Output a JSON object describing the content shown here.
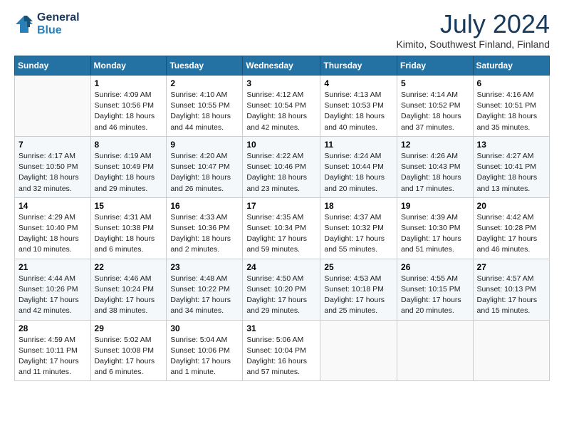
{
  "header": {
    "logo_line1": "General",
    "logo_line2": "Blue",
    "month_title": "July 2024",
    "location": "Kimito, Southwest Finland, Finland"
  },
  "weekdays": [
    "Sunday",
    "Monday",
    "Tuesday",
    "Wednesday",
    "Thursday",
    "Friday",
    "Saturday"
  ],
  "weeks": [
    [
      {
        "day": "",
        "info": ""
      },
      {
        "day": "1",
        "info": "Sunrise: 4:09 AM\nSunset: 10:56 PM\nDaylight: 18 hours\nand 46 minutes."
      },
      {
        "day": "2",
        "info": "Sunrise: 4:10 AM\nSunset: 10:55 PM\nDaylight: 18 hours\nand 44 minutes."
      },
      {
        "day": "3",
        "info": "Sunrise: 4:12 AM\nSunset: 10:54 PM\nDaylight: 18 hours\nand 42 minutes."
      },
      {
        "day": "4",
        "info": "Sunrise: 4:13 AM\nSunset: 10:53 PM\nDaylight: 18 hours\nand 40 minutes."
      },
      {
        "day": "5",
        "info": "Sunrise: 4:14 AM\nSunset: 10:52 PM\nDaylight: 18 hours\nand 37 minutes."
      },
      {
        "day": "6",
        "info": "Sunrise: 4:16 AM\nSunset: 10:51 PM\nDaylight: 18 hours\nand 35 minutes."
      }
    ],
    [
      {
        "day": "7",
        "info": "Sunrise: 4:17 AM\nSunset: 10:50 PM\nDaylight: 18 hours\nand 32 minutes."
      },
      {
        "day": "8",
        "info": "Sunrise: 4:19 AM\nSunset: 10:49 PM\nDaylight: 18 hours\nand 29 minutes."
      },
      {
        "day": "9",
        "info": "Sunrise: 4:20 AM\nSunset: 10:47 PM\nDaylight: 18 hours\nand 26 minutes."
      },
      {
        "day": "10",
        "info": "Sunrise: 4:22 AM\nSunset: 10:46 PM\nDaylight: 18 hours\nand 23 minutes."
      },
      {
        "day": "11",
        "info": "Sunrise: 4:24 AM\nSunset: 10:44 PM\nDaylight: 18 hours\nand 20 minutes."
      },
      {
        "day": "12",
        "info": "Sunrise: 4:26 AM\nSunset: 10:43 PM\nDaylight: 18 hours\nand 17 minutes."
      },
      {
        "day": "13",
        "info": "Sunrise: 4:27 AM\nSunset: 10:41 PM\nDaylight: 18 hours\nand 13 minutes."
      }
    ],
    [
      {
        "day": "14",
        "info": "Sunrise: 4:29 AM\nSunset: 10:40 PM\nDaylight: 18 hours\nand 10 minutes."
      },
      {
        "day": "15",
        "info": "Sunrise: 4:31 AM\nSunset: 10:38 PM\nDaylight: 18 hours\nand 6 minutes."
      },
      {
        "day": "16",
        "info": "Sunrise: 4:33 AM\nSunset: 10:36 PM\nDaylight: 18 hours\nand 2 minutes."
      },
      {
        "day": "17",
        "info": "Sunrise: 4:35 AM\nSunset: 10:34 PM\nDaylight: 17 hours\nand 59 minutes."
      },
      {
        "day": "18",
        "info": "Sunrise: 4:37 AM\nSunset: 10:32 PM\nDaylight: 17 hours\nand 55 minutes."
      },
      {
        "day": "19",
        "info": "Sunrise: 4:39 AM\nSunset: 10:30 PM\nDaylight: 17 hours\nand 51 minutes."
      },
      {
        "day": "20",
        "info": "Sunrise: 4:42 AM\nSunset: 10:28 PM\nDaylight: 17 hours\nand 46 minutes."
      }
    ],
    [
      {
        "day": "21",
        "info": "Sunrise: 4:44 AM\nSunset: 10:26 PM\nDaylight: 17 hours\nand 42 minutes."
      },
      {
        "day": "22",
        "info": "Sunrise: 4:46 AM\nSunset: 10:24 PM\nDaylight: 17 hours\nand 38 minutes."
      },
      {
        "day": "23",
        "info": "Sunrise: 4:48 AM\nSunset: 10:22 PM\nDaylight: 17 hours\nand 34 minutes."
      },
      {
        "day": "24",
        "info": "Sunrise: 4:50 AM\nSunset: 10:20 PM\nDaylight: 17 hours\nand 29 minutes."
      },
      {
        "day": "25",
        "info": "Sunrise: 4:53 AM\nSunset: 10:18 PM\nDaylight: 17 hours\nand 25 minutes."
      },
      {
        "day": "26",
        "info": "Sunrise: 4:55 AM\nSunset: 10:15 PM\nDaylight: 17 hours\nand 20 minutes."
      },
      {
        "day": "27",
        "info": "Sunrise: 4:57 AM\nSunset: 10:13 PM\nDaylight: 17 hours\nand 15 minutes."
      }
    ],
    [
      {
        "day": "28",
        "info": "Sunrise: 4:59 AM\nSunset: 10:11 PM\nDaylight: 17 hours\nand 11 minutes."
      },
      {
        "day": "29",
        "info": "Sunrise: 5:02 AM\nSunset: 10:08 PM\nDaylight: 17 hours\nand 6 minutes."
      },
      {
        "day": "30",
        "info": "Sunrise: 5:04 AM\nSunset: 10:06 PM\nDaylight: 17 hours\nand 1 minute."
      },
      {
        "day": "31",
        "info": "Sunrise: 5:06 AM\nSunset: 10:04 PM\nDaylight: 16 hours\nand 57 minutes."
      },
      {
        "day": "",
        "info": ""
      },
      {
        "day": "",
        "info": ""
      },
      {
        "day": "",
        "info": ""
      }
    ]
  ]
}
